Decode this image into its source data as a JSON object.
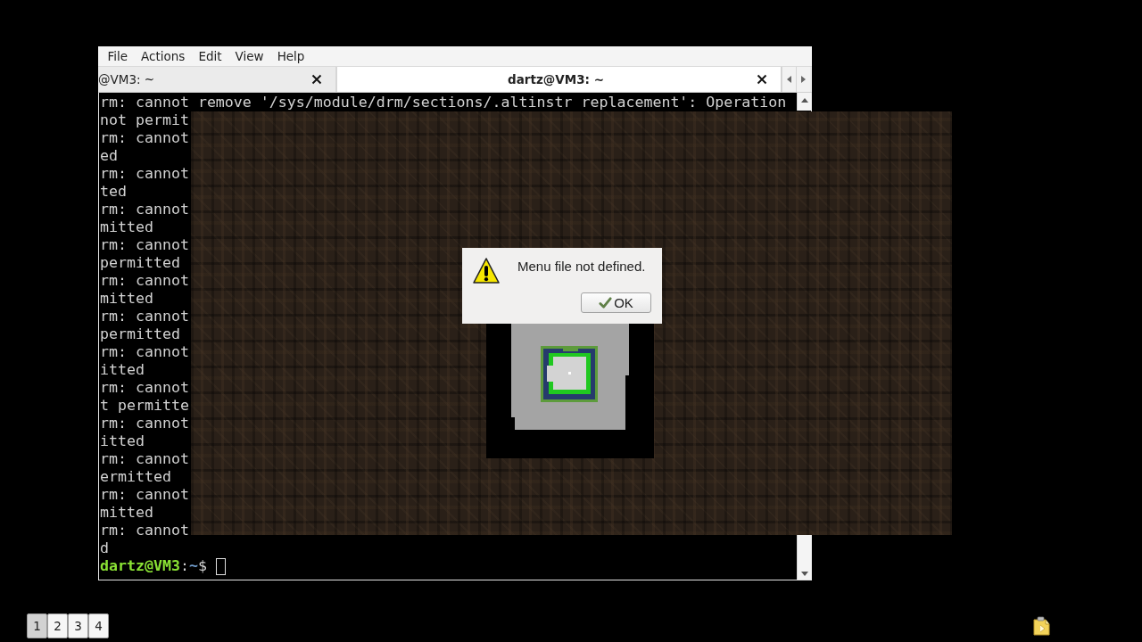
{
  "terminal_window": {
    "menu": [
      "File",
      "Actions",
      "Edit",
      "View",
      "Help"
    ],
    "tabs": [
      {
        "label": "@VM3: ~",
        "selected": false
      },
      {
        "label": "dartz@VM3: ~",
        "selected": true
      }
    ],
    "output_lines": [
      "rm: cannot remove '/sys/module/drm/sections/.altinstr replacement': Operation",
      "not permit",
      "rm: cannot",
      "ed",
      "rm: cannot",
      "ted",
      "rm: cannot",
      "mitted",
      "rm: cannot",
      "permitted",
      "rm: cannot",
      "mitted",
      "rm: cannot",
      "permitted",
      "rm: cannot",
      "itted",
      "rm: cannot",
      "t permitte",
      "rm: cannot",
      "itted",
      "rm: cannot",
      "ermitted",
      "rm: cannot",
      "mitted",
      "rm: cannot",
      "d"
    ],
    "prompt": {
      "user_host": "dartz@VM3",
      "separator": ":",
      "path": "~",
      "symbol": "$"
    }
  },
  "game_window": {
    "dialog": {
      "message": "Menu file not defined.",
      "button": "OK"
    }
  },
  "taskbar": {
    "workspaces": [
      {
        "label": "1",
        "selected": true
      },
      {
        "label": "2",
        "selected": false
      },
      {
        "label": "3",
        "selected": false
      },
      {
        "label": "4",
        "selected": false
      }
    ]
  }
}
